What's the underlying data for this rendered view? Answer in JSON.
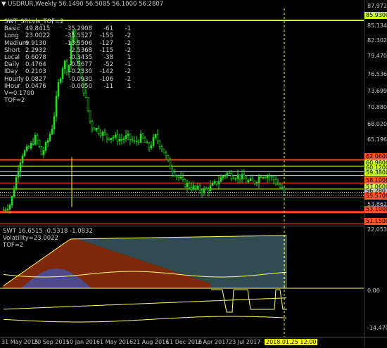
{
  "header": {
    "symbol_title": "USDRUR,Weekly",
    "ohlc": "56.1490 56.5085 56.1000 56.2807",
    "expand_icon": "triangle-down-icon"
  },
  "stats_panel": {
    "title": "SWT_SRLvls_TOF=2",
    "rows": [
      {
        "name": "Basic",
        "v1": "49.8415",
        "v2": "-35.2908",
        "v3": "-61",
        "v4": "-1"
      },
      {
        "name": "Long",
        "v1": "23.0022",
        "v2": "-35.5527",
        "v3": "-155",
        "v4": "-2"
      },
      {
        "name": "Medium",
        "v1": "9.9130",
        "v2": "-13.5506",
        "v3": "-127",
        "v4": "-2"
      },
      {
        "name": "Short",
        "v1": "2.2932",
        "v2": "-2.5368",
        "v3": "-115",
        "v4": "-2"
      },
      {
        "name": "Local",
        "v1": "0.6078",
        "v2": "-0.3435",
        "v3": "-38",
        "v4": "1"
      },
      {
        "name": "Daily",
        "v1": "0.4764",
        "v2": "-0.5677",
        "v3": "-52",
        "v4": "-1"
      },
      {
        "name": "IDay",
        "v1": "0.2103",
        "v2": "-0.2330",
        "v3": "-142",
        "v4": "-2"
      },
      {
        "name": "Hourly",
        "v1": "0.0827",
        "v2": "-0.0930",
        "v3": "-106",
        "v4": "-2"
      },
      {
        "name": "IHour",
        "v1": "0.0476",
        "v2": "-0.0050",
        "v3": "-11",
        "v4": "1"
      }
    ],
    "v_line": "V=0.1700",
    "tof_line": "TOF=2"
  },
  "price_axis": {
    "ticks": [
      "87.9720",
      "85.1340",
      "82.3020",
      "79.4700",
      "76.5360",
      "73.6990",
      "70.8800",
      "68.0200",
      "65.1960",
      "62.3640",
      "59.5300",
      "56.6960",
      "53.8620",
      "51.0280"
    ],
    "tags": [
      {
        "label": "85.9300",
        "color": "#ccff33"
      },
      {
        "label": "62.0600",
        "color": "#ff5522"
      },
      {
        "label": "60.9800",
        "color": "#ccff33"
      },
      {
        "label": "60.1200",
        "color": "#ccff33"
      },
      {
        "label": "59.3800",
        "color": "#ccff33"
      },
      {
        "label": "58.1000",
        "color": "#ff5522"
      },
      {
        "label": "57.0600",
        "color": "#ccff33"
      },
      {
        "label": "56.2807",
        "color": "#c0c0c0"
      },
      {
        "label": "55.5700",
        "color": "#ff5522"
      },
      {
        "label": "53.1000",
        "color": "#ff5522"
      },
      {
        "label": "51.1500",
        "color": "#ff5522"
      }
    ]
  },
  "indicator": {
    "title": "SWT 16.6515 -0.5318 -1.0832",
    "volatility": "Volatility=23.0022",
    "tof": "TOF=2",
    "ticks": [
      "22.0534",
      "0.00",
      "-14.4707"
    ]
  },
  "time_axis": {
    "labels": [
      "31 May 2015",
      "20 Sep 2015",
      "10 Jan 2016",
      "1 May 2016",
      "21 Aug 2016",
      "11 Dec 2016",
      "2 Apr 2017",
      "23 Jul 2017",
      "2018.01.25 12:00"
    ]
  },
  "colors": {
    "candle": "#22dd22",
    "support_red": "#ff4411",
    "level_green": "#ccff33",
    "cursor_yellow": "#ffff00",
    "band_red": "#b03a10",
    "band_cyan": "#7fc8d8"
  },
  "chart_data": {
    "type": "line",
    "title": "USDRUR,Weekly",
    "x": [
      "31 May 2015",
      "20 Sep 2015",
      "10 Jan 2016",
      "1 May 2016",
      "21 Aug 2016",
      "11 Dec 2016",
      "2 Apr 2017",
      "23 Jul 2017",
      "2018.01.25 12:00"
    ],
    "series": [
      {
        "values": [
          54.5,
          64.0,
          79.0,
          67.0,
          65.0,
          61.5,
          58.5,
          58.5,
          56.28
        ]
      }
    ],
    "ylim": [
      51.028,
      87.972
    ]
  }
}
